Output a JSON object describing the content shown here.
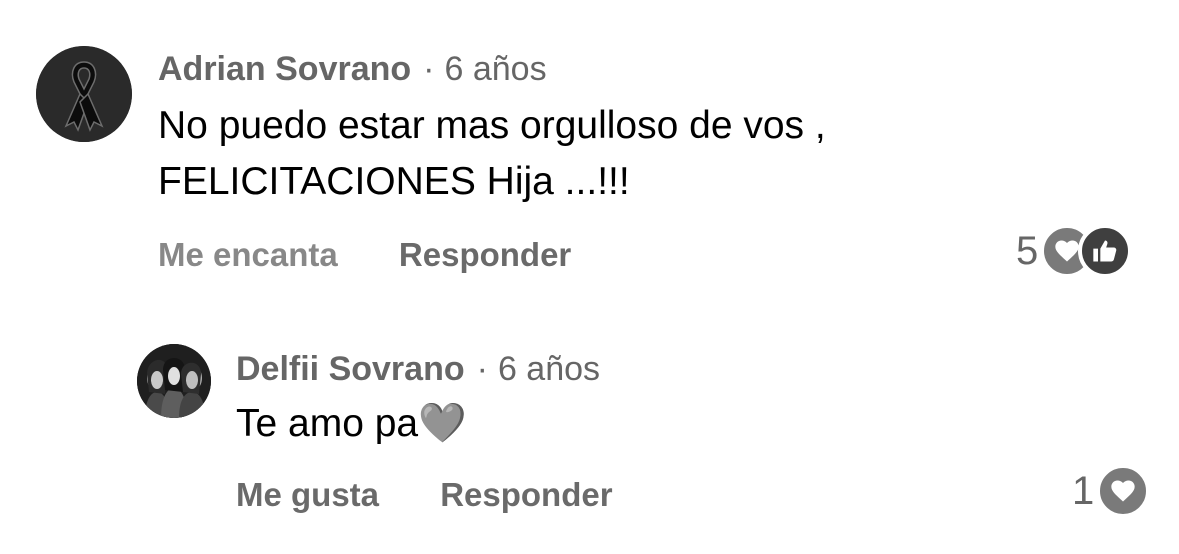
{
  "comments": [
    {
      "author": "Adrian Sovrano",
      "time": "6 años",
      "text_lines": [
        "No puedo estar mas orgulloso de vos ,",
        "FELICITACIONES Hija ...!!!"
      ],
      "actions": {
        "react_label": "Me encanta",
        "reply_label": "Responder"
      },
      "reaction_count": "5",
      "reaction_icons": [
        "heart-icon",
        "thumbs-up-icon"
      ]
    },
    {
      "author": "Delfii Sovrano",
      "time": "6 años",
      "text": "Te amo pa",
      "emoji": "🩶",
      "actions": {
        "react_label": "Me gusta",
        "reply_label": "Responder"
      },
      "reaction_count": "1",
      "reaction_icons": [
        "heart-icon"
      ]
    }
  ],
  "separator": "·",
  "colors": {
    "meta_text": "#666666",
    "action_text": "#777777",
    "heart_reaction": "#7a7a7a",
    "like_reaction": "#3f3f3f"
  }
}
